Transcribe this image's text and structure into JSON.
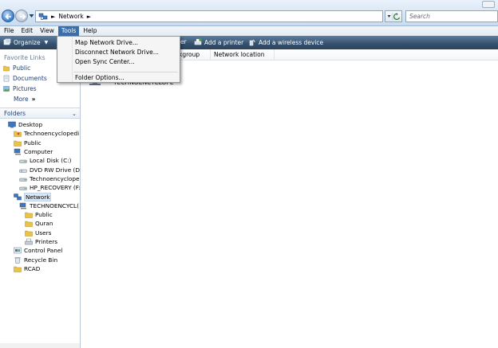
{
  "address": {
    "path": "Network",
    "search_placeholder": "Search"
  },
  "menubar": [
    {
      "label": "File"
    },
    {
      "label": "Edit"
    },
    {
      "label": "View"
    },
    {
      "label": "Tools"
    },
    {
      "label": "Help"
    }
  ],
  "toolbar": {
    "organize": "Organize",
    "hidden_partial": "er",
    "add_printer": "Add a printer",
    "add_wireless": "Add a wireless device"
  },
  "tools_menu": {
    "items": [
      {
        "label": "Map Network Drive..."
      },
      {
        "label": "Disconnect Network Drive..."
      },
      {
        "label": "Open Sync Center..."
      },
      {
        "label": "Folder Options..."
      }
    ]
  },
  "columns": {
    "workgroup_partial": "kgroup",
    "location": "Network location"
  },
  "content_item": {
    "label": "TECHNOENCYCLOPE"
  },
  "favorites": {
    "header": "Favorite Links",
    "items": [
      {
        "label": "Public"
      },
      {
        "label": "Documents"
      },
      {
        "label": "Pictures"
      }
    ],
    "more": "More",
    "more_glyph": "»"
  },
  "folders": {
    "header": "Folders",
    "tree": [
      {
        "label": "Desktop",
        "indent": 1,
        "icon": "desktop-icon"
      },
      {
        "label": "Technoencyclopedi",
        "indent": 2,
        "icon": "user-folder-icon"
      },
      {
        "label": "Public",
        "indent": 2,
        "icon": "folder-icon"
      },
      {
        "label": "Computer",
        "indent": 2,
        "icon": "computer-icon"
      },
      {
        "label": "Local Disk (C:)",
        "indent": 3,
        "icon": "drive-icon"
      },
      {
        "label": "DVD RW Drive (D:)",
        "indent": 3,
        "icon": "dvd-icon"
      },
      {
        "label": "Technoencyclope",
        "indent": 3,
        "icon": "drive-icon"
      },
      {
        "label": "HP_RECOVERY (F:",
        "indent": 3,
        "icon": "drive-icon"
      },
      {
        "label": "Network",
        "indent": 2,
        "icon": "network-icon",
        "selected": true
      },
      {
        "label": "TECHNOENCYCL(",
        "indent": 3,
        "icon": "computer-icon"
      },
      {
        "label": "Public",
        "indent": 4,
        "icon": "folder-icon"
      },
      {
        "label": "Quran",
        "indent": 4,
        "icon": "folder-icon"
      },
      {
        "label": "Users",
        "indent": 4,
        "icon": "folder-icon"
      },
      {
        "label": "Printers",
        "indent": 4,
        "icon": "printer-icon"
      },
      {
        "label": "Control Panel",
        "indent": 2,
        "icon": "control-panel-icon"
      },
      {
        "label": "Recycle Bin",
        "indent": 2,
        "icon": "recycle-bin-icon"
      },
      {
        "label": "RCAD",
        "indent": 2,
        "icon": "folder-icon"
      }
    ]
  },
  "colors": {
    "toolbar": "#34506d",
    "menu_active": "#3a6ea8",
    "link": "#1e3f73"
  }
}
